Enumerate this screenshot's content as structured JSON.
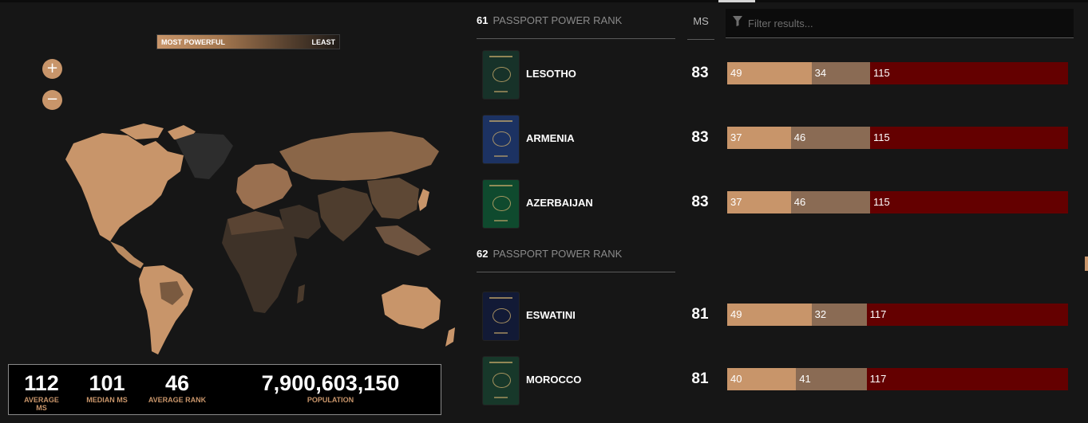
{
  "legend": {
    "most": "MOST POWERFUL",
    "least": "LEAST"
  },
  "zoom": {
    "in": "+",
    "out": "−"
  },
  "stats": [
    {
      "value": "112",
      "label": "AVERAGE MS"
    },
    {
      "value": "101",
      "label": "MEDIAN MS"
    },
    {
      "value": "46",
      "label": "AVERAGE RANK"
    },
    {
      "value": "7,900,603,150",
      "label": "POPULATION"
    }
  ],
  "ranks": [
    {
      "number": "61",
      "label": "PASSPORT POWER RANK"
    },
    {
      "number": "62",
      "label": "PASSPORT POWER RANK"
    }
  ],
  "ms_header": "MS",
  "filter": {
    "placeholder": "Filter results..."
  },
  "rows": [
    {
      "country": "LESOTHO",
      "ms": "83",
      "visa_free": 49,
      "visa_on_arrival": 34,
      "visa_required": 115,
      "cover_color": "#173229"
    },
    {
      "country": "ARMENIA",
      "ms": "83",
      "visa_free": 37,
      "visa_on_arrival": 46,
      "visa_required": 115,
      "cover_color": "#1c3262"
    },
    {
      "country": "AZERBAIJAN",
      "ms": "83",
      "visa_free": 37,
      "visa_on_arrival": 46,
      "visa_required": 115,
      "cover_color": "#0f4a2e"
    },
    {
      "country": "ESWATINI",
      "ms": "81",
      "visa_free": 49,
      "visa_on_arrival": 32,
      "visa_required": 117,
      "cover_color": "#121a36"
    },
    {
      "country": "MOROCCO",
      "ms": "81",
      "visa_free": 40,
      "visa_on_arrival": 41,
      "visa_required": 117,
      "cover_color": "#17382a"
    }
  ],
  "colors": {
    "accent": "#c8956a",
    "mid": "#8a6b54",
    "required": "#640000",
    "background": "#161616"
  }
}
